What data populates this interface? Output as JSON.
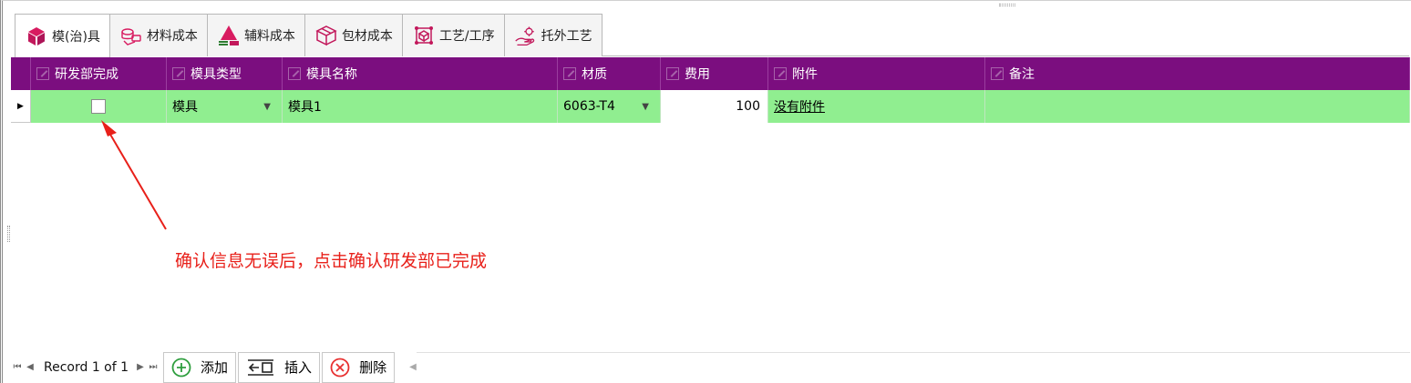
{
  "tabs": [
    {
      "label": "模(治)具",
      "icon": "box-icon",
      "active": true
    },
    {
      "label": "材料成本",
      "icon": "materials-icon",
      "active": false
    },
    {
      "label": "辅料成本",
      "icon": "layers-icon",
      "active": false
    },
    {
      "label": "包材成本",
      "icon": "package-icon",
      "active": false
    },
    {
      "label": "工艺/工序",
      "icon": "process-icon",
      "active": false
    },
    {
      "label": "托外工艺",
      "icon": "outsource-hand-icon",
      "active": false
    }
  ],
  "grid": {
    "columns": [
      "研发部完成",
      "模具类型",
      "模具名称",
      "材质",
      "费用",
      "附件",
      "备注"
    ],
    "row": {
      "done": false,
      "type": "模具",
      "name": "模具1",
      "material": "6063-T4",
      "fee": "100",
      "attachment": "没有附件",
      "remark": ""
    }
  },
  "annotation": "确认信息无误后，点击确认研发部已完成",
  "navigator": {
    "record_text": "Record 1 of 1",
    "add_label": "添加",
    "insert_label": "插入",
    "delete_label": "删除"
  },
  "colors": {
    "header_bg": "#7b0e7f",
    "row_bg": "#90ee90",
    "annotation": "#e8201a",
    "add_icon": "#2e9e3e",
    "delete_icon": "#e83030"
  }
}
